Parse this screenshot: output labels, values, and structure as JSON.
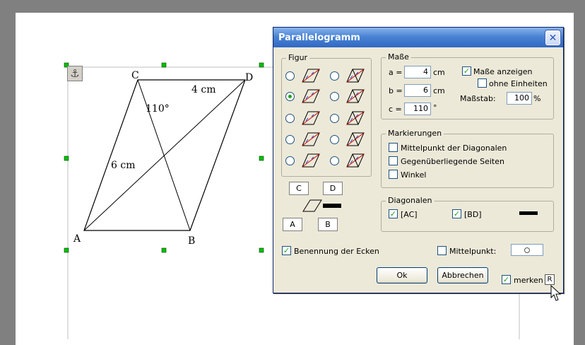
{
  "drawing": {
    "vertices": {
      "a": "A",
      "b": "B",
      "c": "C",
      "d": "D"
    },
    "side_top": "4 cm",
    "side_left": "6 cm",
    "angle": "110°",
    "anchor_icon": "anchor-icon"
  },
  "dialog": {
    "title": "Parallelogramm",
    "close_icon": "close-icon",
    "figur": {
      "title": "Figur"
    },
    "corner_boxes": {
      "c": "C",
      "d": "D",
      "a": "A",
      "b": "B"
    },
    "masse": {
      "title": "Maße",
      "a_label": "a =",
      "a_value": "4",
      "a_unit": "cm",
      "b_label": "b =",
      "b_value": "6",
      "b_unit": "cm",
      "c_label": "c =",
      "c_value": "110",
      "c_unit": "°",
      "show_dims_label": "Maße anzeigen",
      "no_units_label": "ohne Einheiten",
      "scale_label": "Maßstab:",
      "scale_value": "100",
      "scale_unit": "%"
    },
    "markierungen": {
      "title": "Markierungen",
      "items": [
        "Mittelpunkt der Diagonalen",
        "Gegenüberliegende Seiten",
        "Winkel"
      ]
    },
    "diagonalen": {
      "title": "Diagonalen",
      "ac": "[AC]",
      "bd": "[BD]"
    },
    "corner_naming_label": "Benennung der Ecken",
    "midpoint_label": "Mittelpunkt:",
    "ok_label": "Ok",
    "cancel_label": "Abbrechen",
    "remember_label": "merken",
    "r_label": "R"
  }
}
